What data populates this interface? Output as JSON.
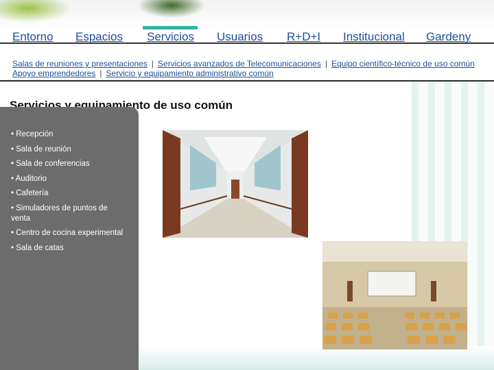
{
  "nav": {
    "items": [
      {
        "label": "Entorno"
      },
      {
        "label": "Espacios"
      },
      {
        "label": "Servicios",
        "active": true
      },
      {
        "label": "Usuarios"
      },
      {
        "label": "R+D+I"
      },
      {
        "label": "Institucional"
      },
      {
        "label": "Gardeny"
      }
    ]
  },
  "subnav": {
    "row1": [
      "Salas de reuniones y presentaciones",
      "Servicios avanzados de Telecomunicaciones",
      "Equipo científico-técnico de uso común"
    ],
    "row2": [
      "Apoyo emprendedores",
      "Servicio y equipamiento administrativo común"
    ],
    "separator": "|"
  },
  "page": {
    "title": "Servicios y equipamiento de uso común"
  },
  "services": [
    "• Recepción",
    "• Sala de reunión",
    "• Sala de conferencias",
    "• Auditorio",
    "• Cafetería",
    "• Simuladores de puntos de venta",
    "• Centro de cocina experimental",
    "• Sala de catas"
  ],
  "colors": {
    "accent": "#33b3a7",
    "link": "#1d4f9a",
    "panel": "#6c6c6c"
  }
}
